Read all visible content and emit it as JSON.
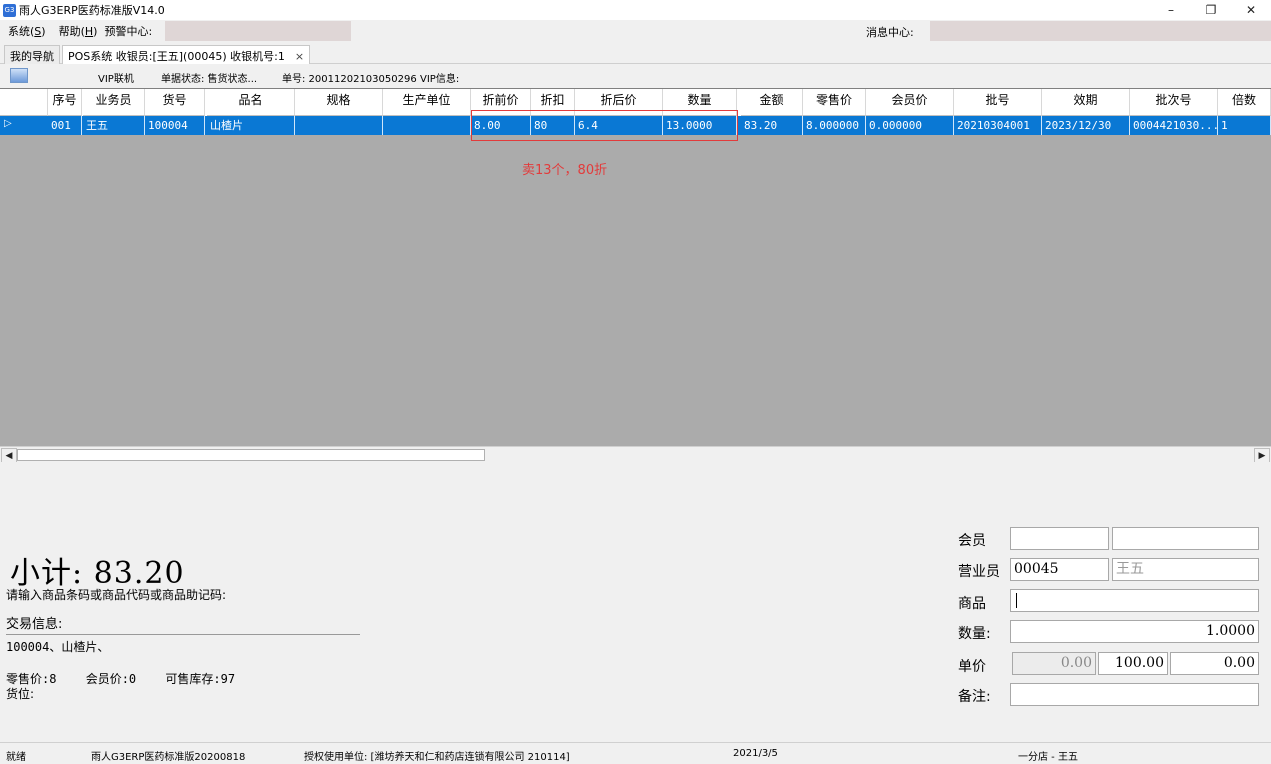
{
  "window": {
    "title": "雨人G3ERP医药标准版V14.0",
    "icon_text": "G3",
    "controls": [
      "minimize-icon",
      "restore-icon",
      "close-icon"
    ]
  },
  "menu": {
    "system_pre": "系统(",
    "system_key": "S",
    "system_post": ")",
    "help_pre": "帮助(",
    "help_key": "H",
    "help_post": ")",
    "alert_center": "预警中心:",
    "message_center": "消息中心:"
  },
  "tabs": {
    "nav": "我的导航",
    "pos": "POS系统 收银员:[王五](00045) 收银机号:1",
    "close": "×"
  },
  "toolbar": {
    "vip_link": "VIP联机",
    "bill_status": "单据状态: 售货状态...",
    "bill_no": "单号: 20011202103050296",
    "vip_info": "VIP信息:"
  },
  "grid": {
    "columns": [
      "序号",
      "业务员",
      "货号",
      "品名",
      "规格",
      "生产单位",
      "折前价",
      "折扣",
      "折后价",
      "数量",
      "金额",
      "零售价",
      "会员价",
      "批号",
      "效期",
      "批次号",
      "倍数"
    ],
    "rows": [
      {
        "indicator": "▷",
        "cells": [
          "001",
          "王五",
          "100004",
          "山楂片",
          "",
          "",
          "8.00",
          "80",
          "6.4",
          "13.0000",
          "83.20",
          "8.000000",
          "0.000000",
          "20210304001",
          "2023/12/30",
          "0004421030...",
          "1"
        ]
      }
    ],
    "annotation": "卖13个，80折"
  },
  "scroll": {
    "left": "◀",
    "right": "▶"
  },
  "summary": {
    "subtotal": "小计: 83.20",
    "prompt": "请输入商品条码或商品代码或商品助记码:",
    "trade_label": "交易信息:",
    "trade_info": "100004、山楂片、",
    "retail_price": "零售价:8",
    "member_price": "会员价:0",
    "stock": "可售库存:97",
    "location": "货位:"
  },
  "form": {
    "member_label": "会员",
    "member_value": "",
    "member_name": "",
    "clerk_label": "营业员",
    "clerk_code": "00045",
    "clerk_name": "王五",
    "goods_label": "商品",
    "goods_value": "",
    "qty_label": "数量:",
    "qty_value": "1.0000",
    "price_label": "单价",
    "price_1": "0.00",
    "price_2": "100.00",
    "price_3": "0.00",
    "remark_label": "备注:",
    "remark_value": ""
  },
  "status": {
    "ready": "就绪",
    "version": "雨人G3ERP医药标准版20200818",
    "license": "授权使用单位: [潍坊养天和仁和药店连锁有限公司 210114]",
    "date": "2021/3/5",
    "store": "一分店 - 王五"
  },
  "colors": {
    "selection": "#0a78d4",
    "grid_bg": "#ababab",
    "annotation": "#e23b3b"
  }
}
